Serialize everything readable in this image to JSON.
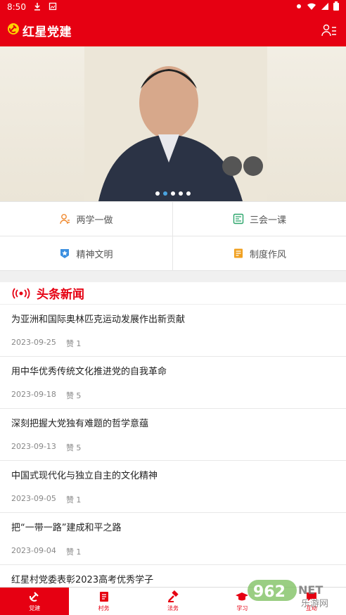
{
  "status_bar": {
    "time": "8:50"
  },
  "app": {
    "title": "红星党建"
  },
  "banner": {
    "dots": 5,
    "active_dot": 1
  },
  "menu": [
    {
      "label": "两学一做"
    },
    {
      "label": "三会一课"
    },
    {
      "label": "精神文明"
    },
    {
      "label": "制度作风"
    }
  ],
  "section": {
    "title": "头条新闻"
  },
  "news": [
    {
      "title": "为亚洲和国际奥林匹克运动发展作出新贡献",
      "date": "2023-09-25",
      "likes": "赞 1"
    },
    {
      "title": "用中华优秀传统文化推进党的自我革命",
      "date": "2023-09-18",
      "likes": "赞 5"
    },
    {
      "title": "深刻把握大党独有难题的哲学意蕴",
      "date": "2023-09-13",
      "likes": "赞 5"
    },
    {
      "title": "中国式现代化与独立自主的文化精神",
      "date": "2023-09-05",
      "likes": "赞 1"
    },
    {
      "title": "把“一带一路”建成和平之路",
      "date": "2023-09-04",
      "likes": "赞 1"
    },
    {
      "title": "红星村党委表彰2023高考优秀学子"
    }
  ],
  "tabs": [
    {
      "label": "党建"
    },
    {
      "label": "村务"
    },
    {
      "label": "法务"
    },
    {
      "label": "学习"
    },
    {
      "label": "互动"
    }
  ],
  "watermark": {
    "text": "962",
    "suffix": "NET",
    "sub": "乐游网"
  },
  "colors": {
    "brand": "#e60012",
    "dot_active": "#4aa3df"
  }
}
